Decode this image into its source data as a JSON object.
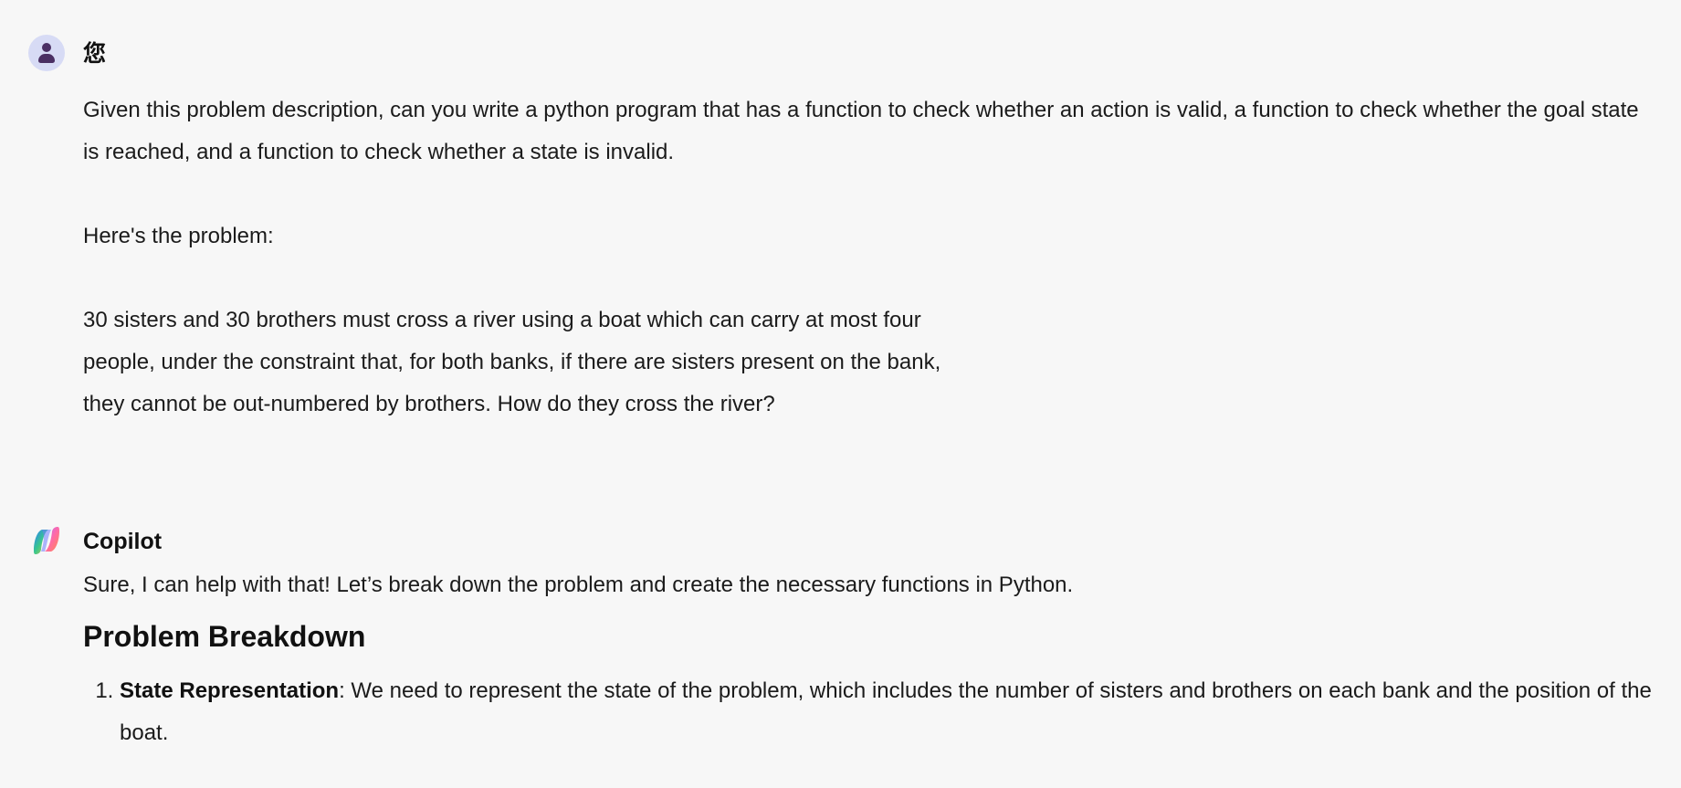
{
  "user_message": {
    "sender": "您",
    "paragraphs": [
      "Given this problem description, can you write a python program that has a function to check whether an action is valid, a function to check whether the goal state is reached, and a function to check whether a state is invalid.",
      "Here's the problem:",
      "30 sisters and 30 brothers must cross a river using a boat which can carry at most four",
      "people, under the constraint that, for both banks, if there are sisters present on the bank,",
      "they cannot be out-numbered by brothers. How do they cross the river?"
    ]
  },
  "assistant_message": {
    "sender": "Copilot",
    "intro": "Sure, I can help with that! Let’s break down the problem and create the necessary functions in Python.",
    "heading": "Problem Breakdown",
    "list_items": [
      {
        "term": "State Representation",
        "text": ": We need to represent the state of the problem, which includes the number of sisters and brothers on each bank and the position of the boat."
      }
    ]
  },
  "colors": {
    "background": "#f7f7f7",
    "user_avatar_bg": "#d7dbf5",
    "user_avatar_fg": "#4a2f63"
  },
  "icons": {
    "user_avatar": "person-icon",
    "assistant_avatar": "copilot-logo-icon"
  }
}
